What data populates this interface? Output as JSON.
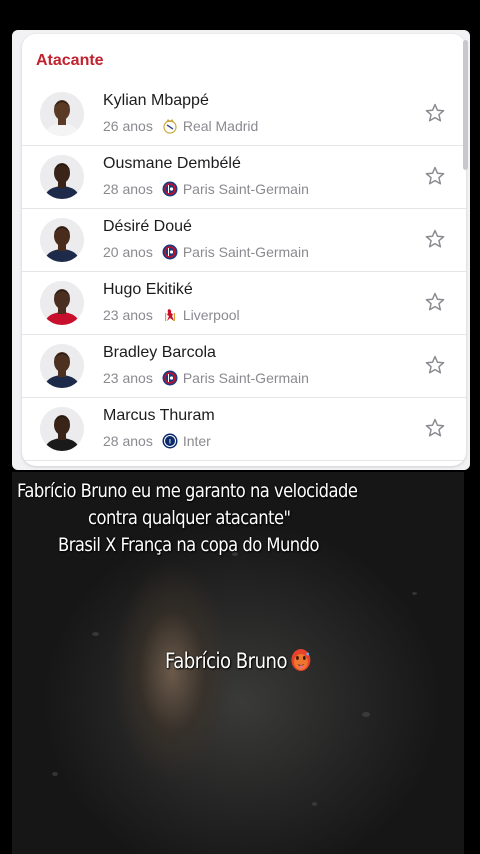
{
  "section": {
    "title": "Atacante"
  },
  "players": [
    {
      "name": "Kylian Mbappé",
      "age": "26 anos",
      "club": "Real Madrid",
      "club_icon": "real-madrid-crest-icon",
      "shirt_color": "#f4f4f4",
      "skin": "#5a3a24"
    },
    {
      "name": "Ousmane Dembélé",
      "age": "28 anos",
      "club": "Paris Saint-Germain",
      "club_icon": "psg-crest-icon",
      "shirt_color": "#1d2a4a",
      "skin": "#3a2418"
    },
    {
      "name": "Désiré Doué",
      "age": "20 anos",
      "club": "Paris Saint-Germain",
      "club_icon": "psg-crest-icon",
      "shirt_color": "#1d2a4a",
      "skin": "#4a2c1c"
    },
    {
      "name": "Hugo Ekitiké",
      "age": "23 anos",
      "club": "Liverpool",
      "club_icon": "liverpool-crest-icon",
      "shirt_color": "#c8102e",
      "skin": "#4a2e1f"
    },
    {
      "name": "Bradley Barcola",
      "age": "23 anos",
      "club": "Paris Saint-Germain",
      "club_icon": "psg-crest-icon",
      "shirt_color": "#1d2a4a",
      "skin": "#4e3020"
    },
    {
      "name": "Marcus Thuram",
      "age": "28 anos",
      "club": "Inter",
      "club_icon": "inter-crest-icon",
      "shirt_color": "#1a1a1a",
      "skin": "#3a2418"
    }
  ],
  "video": {
    "caption_line1": "Fabrício Bruno eu me garanto na velocidade",
    "caption_line2": "contra qualquer atacante\"",
    "caption_line3": "Brasil X França na copa do Mundo",
    "overlay_label": "Fabrício Bruno",
    "overlay_emoji": "hot-face-emoji"
  },
  "colors": {
    "accent": "#c0232f",
    "psg_blue": "#1d3a7a",
    "liverpool_red": "#c8102e"
  }
}
